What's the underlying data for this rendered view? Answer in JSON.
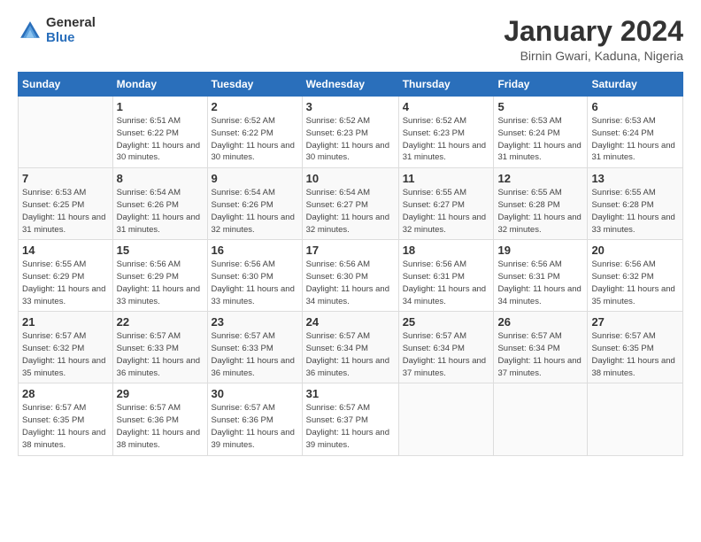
{
  "logo": {
    "general": "General",
    "blue": "Blue"
  },
  "header": {
    "month_year": "January 2024",
    "location": "Birnin Gwari, Kaduna, Nigeria"
  },
  "days_of_week": [
    "Sunday",
    "Monday",
    "Tuesday",
    "Wednesday",
    "Thursday",
    "Friday",
    "Saturday"
  ],
  "weeks": [
    [
      {
        "day": "",
        "sunrise": "",
        "sunset": "",
        "daylight": ""
      },
      {
        "day": "1",
        "sunrise": "Sunrise: 6:51 AM",
        "sunset": "Sunset: 6:22 PM",
        "daylight": "Daylight: 11 hours and 30 minutes."
      },
      {
        "day": "2",
        "sunrise": "Sunrise: 6:52 AM",
        "sunset": "Sunset: 6:22 PM",
        "daylight": "Daylight: 11 hours and 30 minutes."
      },
      {
        "day": "3",
        "sunrise": "Sunrise: 6:52 AM",
        "sunset": "Sunset: 6:23 PM",
        "daylight": "Daylight: 11 hours and 30 minutes."
      },
      {
        "day": "4",
        "sunrise": "Sunrise: 6:52 AM",
        "sunset": "Sunset: 6:23 PM",
        "daylight": "Daylight: 11 hours and 31 minutes."
      },
      {
        "day": "5",
        "sunrise": "Sunrise: 6:53 AM",
        "sunset": "Sunset: 6:24 PM",
        "daylight": "Daylight: 11 hours and 31 minutes."
      },
      {
        "day": "6",
        "sunrise": "Sunrise: 6:53 AM",
        "sunset": "Sunset: 6:24 PM",
        "daylight": "Daylight: 11 hours and 31 minutes."
      }
    ],
    [
      {
        "day": "7",
        "sunrise": "Sunrise: 6:53 AM",
        "sunset": "Sunset: 6:25 PM",
        "daylight": "Daylight: 11 hours and 31 minutes."
      },
      {
        "day": "8",
        "sunrise": "Sunrise: 6:54 AM",
        "sunset": "Sunset: 6:26 PM",
        "daylight": "Daylight: 11 hours and 31 minutes."
      },
      {
        "day": "9",
        "sunrise": "Sunrise: 6:54 AM",
        "sunset": "Sunset: 6:26 PM",
        "daylight": "Daylight: 11 hours and 32 minutes."
      },
      {
        "day": "10",
        "sunrise": "Sunrise: 6:54 AM",
        "sunset": "Sunset: 6:27 PM",
        "daylight": "Daylight: 11 hours and 32 minutes."
      },
      {
        "day": "11",
        "sunrise": "Sunrise: 6:55 AM",
        "sunset": "Sunset: 6:27 PM",
        "daylight": "Daylight: 11 hours and 32 minutes."
      },
      {
        "day": "12",
        "sunrise": "Sunrise: 6:55 AM",
        "sunset": "Sunset: 6:28 PM",
        "daylight": "Daylight: 11 hours and 32 minutes."
      },
      {
        "day": "13",
        "sunrise": "Sunrise: 6:55 AM",
        "sunset": "Sunset: 6:28 PM",
        "daylight": "Daylight: 11 hours and 33 minutes."
      }
    ],
    [
      {
        "day": "14",
        "sunrise": "Sunrise: 6:55 AM",
        "sunset": "Sunset: 6:29 PM",
        "daylight": "Daylight: 11 hours and 33 minutes."
      },
      {
        "day": "15",
        "sunrise": "Sunrise: 6:56 AM",
        "sunset": "Sunset: 6:29 PM",
        "daylight": "Daylight: 11 hours and 33 minutes."
      },
      {
        "day": "16",
        "sunrise": "Sunrise: 6:56 AM",
        "sunset": "Sunset: 6:30 PM",
        "daylight": "Daylight: 11 hours and 33 minutes."
      },
      {
        "day": "17",
        "sunrise": "Sunrise: 6:56 AM",
        "sunset": "Sunset: 6:30 PM",
        "daylight": "Daylight: 11 hours and 34 minutes."
      },
      {
        "day": "18",
        "sunrise": "Sunrise: 6:56 AM",
        "sunset": "Sunset: 6:31 PM",
        "daylight": "Daylight: 11 hours and 34 minutes."
      },
      {
        "day": "19",
        "sunrise": "Sunrise: 6:56 AM",
        "sunset": "Sunset: 6:31 PM",
        "daylight": "Daylight: 11 hours and 34 minutes."
      },
      {
        "day": "20",
        "sunrise": "Sunrise: 6:56 AM",
        "sunset": "Sunset: 6:32 PM",
        "daylight": "Daylight: 11 hours and 35 minutes."
      }
    ],
    [
      {
        "day": "21",
        "sunrise": "Sunrise: 6:57 AM",
        "sunset": "Sunset: 6:32 PM",
        "daylight": "Daylight: 11 hours and 35 minutes."
      },
      {
        "day": "22",
        "sunrise": "Sunrise: 6:57 AM",
        "sunset": "Sunset: 6:33 PM",
        "daylight": "Daylight: 11 hours and 36 minutes."
      },
      {
        "day": "23",
        "sunrise": "Sunrise: 6:57 AM",
        "sunset": "Sunset: 6:33 PM",
        "daylight": "Daylight: 11 hours and 36 minutes."
      },
      {
        "day": "24",
        "sunrise": "Sunrise: 6:57 AM",
        "sunset": "Sunset: 6:34 PM",
        "daylight": "Daylight: 11 hours and 36 minutes."
      },
      {
        "day": "25",
        "sunrise": "Sunrise: 6:57 AM",
        "sunset": "Sunset: 6:34 PM",
        "daylight": "Daylight: 11 hours and 37 minutes."
      },
      {
        "day": "26",
        "sunrise": "Sunrise: 6:57 AM",
        "sunset": "Sunset: 6:34 PM",
        "daylight": "Daylight: 11 hours and 37 minutes."
      },
      {
        "day": "27",
        "sunrise": "Sunrise: 6:57 AM",
        "sunset": "Sunset: 6:35 PM",
        "daylight": "Daylight: 11 hours and 38 minutes."
      }
    ],
    [
      {
        "day": "28",
        "sunrise": "Sunrise: 6:57 AM",
        "sunset": "Sunset: 6:35 PM",
        "daylight": "Daylight: 11 hours and 38 minutes."
      },
      {
        "day": "29",
        "sunrise": "Sunrise: 6:57 AM",
        "sunset": "Sunset: 6:36 PM",
        "daylight": "Daylight: 11 hours and 38 minutes."
      },
      {
        "day": "30",
        "sunrise": "Sunrise: 6:57 AM",
        "sunset": "Sunset: 6:36 PM",
        "daylight": "Daylight: 11 hours and 39 minutes."
      },
      {
        "day": "31",
        "sunrise": "Sunrise: 6:57 AM",
        "sunset": "Sunset: 6:37 PM",
        "daylight": "Daylight: 11 hours and 39 minutes."
      },
      {
        "day": "",
        "sunrise": "",
        "sunset": "",
        "daylight": ""
      },
      {
        "day": "",
        "sunrise": "",
        "sunset": "",
        "daylight": ""
      },
      {
        "day": "",
        "sunrise": "",
        "sunset": "",
        "daylight": ""
      }
    ]
  ]
}
